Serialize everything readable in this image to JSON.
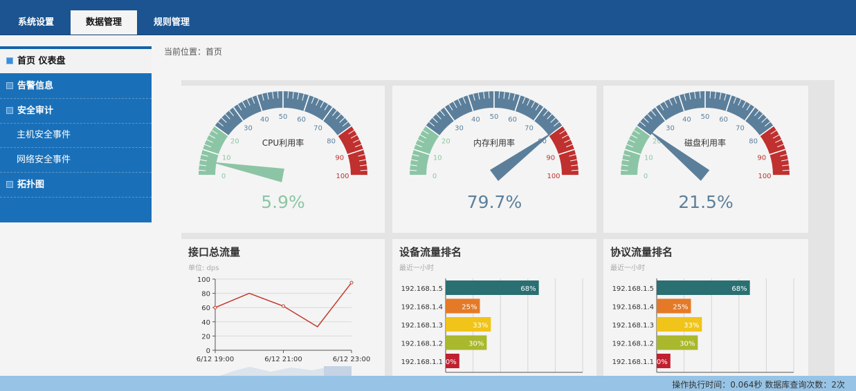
{
  "tabs": [
    {
      "label": "系统设置",
      "active": false
    },
    {
      "label": "数据管理",
      "active": true
    },
    {
      "label": "规则管理",
      "active": false
    }
  ],
  "sidebar": {
    "items": [
      {
        "label": "首页 仪表盘"
      },
      {
        "label": "告警信息"
      },
      {
        "label": "安全审计"
      },
      {
        "label": "主机安全事件"
      },
      {
        "label": "网络安全事件"
      },
      {
        "label": "拓扑图"
      }
    ]
  },
  "breadcrumb": "当前位置：首页",
  "gauges": [
    {
      "label": "CPU利用率",
      "value": 5.9,
      "display": "5.9%",
      "color": "#8cc5a5"
    },
    {
      "label": "内存利用率",
      "value": 79.7,
      "display": "79.7%",
      "color": "#5b7f9b"
    },
    {
      "label": "磁盘利用率",
      "value": 21.5,
      "display": "21.5%",
      "color": "#5b7f9b"
    }
  ],
  "gauge_ticks": [
    "0",
    "10",
    "20",
    "30",
    "40",
    "50",
    "60",
    "70",
    "80",
    "90",
    "100"
  ],
  "colors": {
    "gauge_green": "#8cc5a5",
    "gauge_blue": "#5b7f9b",
    "gauge_red": "#bf302f",
    "topbar": "#1b5490",
    "sidebar": "#1a70b8"
  },
  "panels": {
    "traffic": {
      "title": "接口总流量",
      "subtitle": "单位: dps"
    },
    "device": {
      "title": "设备流量排名",
      "subtitle": "最近一小时"
    },
    "protocol": {
      "title": "协议流量排名",
      "subtitle": "最近一小时"
    }
  },
  "chart_data": [
    {
      "type": "line",
      "title": "接口总流量",
      "subtitle": "单位: dps",
      "x": [
        "6/12 19:00",
        "6/12 20:00",
        "6/12 21:00",
        "6/12 22:00",
        "6/12 23:00"
      ],
      "tick_labels": [
        "6/12 19:00",
        "6/12 21:00",
        "6/12 23:00"
      ],
      "values": [
        60,
        80,
        62,
        33,
        95
      ],
      "ylim": [
        0,
        100
      ],
      "yticks": [
        "0",
        "20",
        "40",
        "60",
        "80",
        "100"
      ],
      "color": "#c0392b"
    },
    {
      "type": "bar",
      "orientation": "horizontal",
      "title": "设备流量排名",
      "subtitle": "最近一小时",
      "categories": [
        "192.168.1.5",
        "192.168.1.4",
        "192.168.1.3",
        "192.168.1.2",
        "192.168.1.1"
      ],
      "values": [
        68,
        25,
        33,
        30,
        10
      ],
      "labels": [
        "68%",
        "25%",
        "33%",
        "30%",
        "0%"
      ],
      "colors": [
        "#2a6f72",
        "#e47a27",
        "#f0c419",
        "#a9b82c",
        "#c0202f"
      ],
      "xlim": [
        0,
        100
      ]
    },
    {
      "type": "bar",
      "orientation": "horizontal",
      "title": "协议流量排名",
      "subtitle": "最近一小时",
      "categories": [
        "192.168.1.5",
        "192.168.1.4",
        "192.168.1.3",
        "192.168.1.2",
        "192.168.1.1"
      ],
      "values": [
        68,
        25,
        33,
        30,
        10
      ],
      "labels": [
        "68%",
        "25%",
        "33%",
        "30%",
        "0%"
      ],
      "colors": [
        "#2a6f72",
        "#e47a27",
        "#f0c419",
        "#a9b82c",
        "#c0202f"
      ],
      "xlim": [
        0,
        100
      ]
    }
  ],
  "footer": "操作执行时间：0.064秒 数据库查询次数：2次"
}
